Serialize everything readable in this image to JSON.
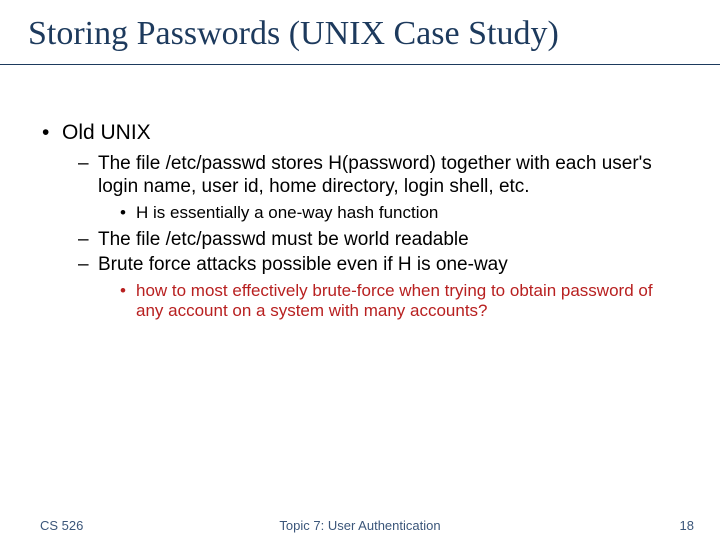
{
  "title": "Storing Passwords (UNIX Case Study)",
  "body": {
    "lvl1": "Old UNIX",
    "p1": "The file /etc/passwd stores H(password) together with each user's login name, user id, home directory, login shell, etc.",
    "p1a": "H is essentially a one-way hash function",
    "p2": "The file /etc/passwd  must be world readable",
    "p3": "Brute force attacks possible even if H is one-way",
    "p3a": "how to most effectively brute-force when trying to obtain password of any account on a system with many accounts?"
  },
  "footer": {
    "left": "CS 526",
    "center": "Topic 7: User Authentication",
    "right": "18"
  }
}
